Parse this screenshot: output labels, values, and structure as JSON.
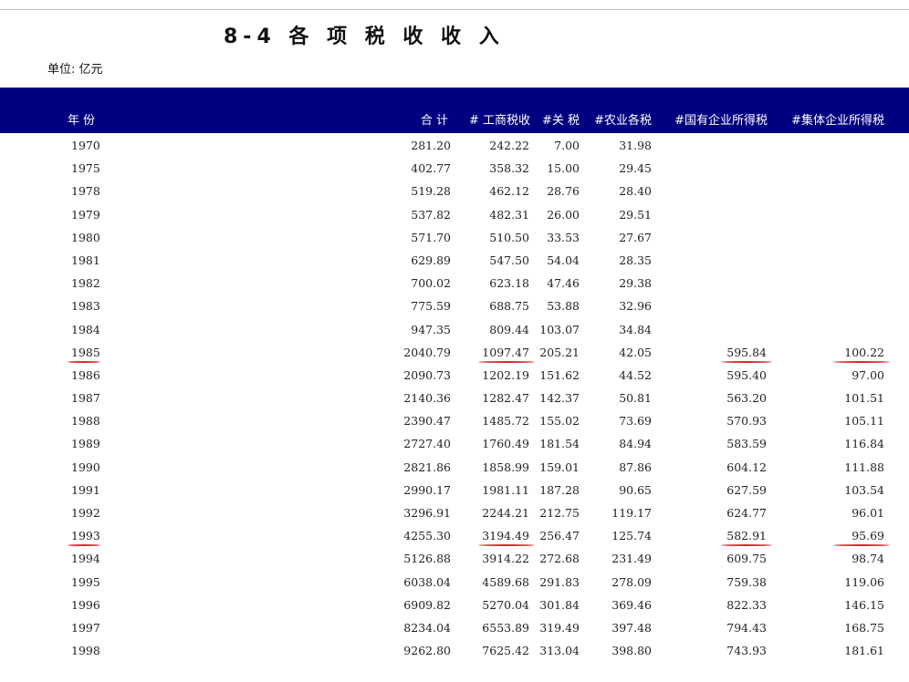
{
  "title": "8-4 各 项 税 收 收 入",
  "unit": "单位: 亿元",
  "accent_colors": {
    "header_band": "#000080",
    "annotation": "#e0202a"
  },
  "table": {
    "headers": [
      "年 份",
      "合 计",
      "# 工商税收",
      "#关 税",
      "#农业各税",
      "#国有企业所得税",
      "#集体企业所得税"
    ],
    "rows": [
      [
        "1970",
        "281.20",
        "242.22",
        "7.00",
        "31.98",
        "",
        ""
      ],
      [
        "1975",
        "402.77",
        "358.32",
        "15.00",
        "29.45",
        "",
        ""
      ],
      [
        "1978",
        "519.28",
        "462.12",
        "28.76",
        "28.40",
        "",
        ""
      ],
      [
        "1979",
        "537.82",
        "482.31",
        "26.00",
        "29.51",
        "",
        ""
      ],
      [
        "1980",
        "571.70",
        "510.50",
        "33.53",
        "27.67",
        "",
        ""
      ],
      [
        "1981",
        "629.89",
        "547.50",
        "54.04",
        "28.35",
        "",
        ""
      ],
      [
        "1982",
        "700.02",
        "623.18",
        "47.46",
        "29.38",
        "",
        ""
      ],
      [
        "1983",
        "775.59",
        "688.75",
        "53.88",
        "32.96",
        "",
        ""
      ],
      [
        "1984",
        "947.35",
        "809.44",
        "103.07",
        "34.84",
        "",
        ""
      ],
      [
        "1985",
        "2040.79",
        "1097.47",
        "205.21",
        "42.05",
        "595.84",
        "100.22"
      ],
      [
        "1986",
        "2090.73",
        "1202.19",
        "151.62",
        "44.52",
        "595.40",
        "97.00"
      ],
      [
        "1987",
        "2140.36",
        "1282.47",
        "142.37",
        "50.81",
        "563.20",
        "101.51"
      ],
      [
        "1988",
        "2390.47",
        "1485.72",
        "155.02",
        "73.69",
        "570.93",
        "105.11"
      ],
      [
        "1989",
        "2727.40",
        "1760.49",
        "181.54",
        "84.94",
        "583.59",
        "116.84"
      ],
      [
        "1990",
        "2821.86",
        "1858.99",
        "159.01",
        "87.86",
        "604.12",
        "111.88"
      ],
      [
        "1991",
        "2990.17",
        "1981.11",
        "187.28",
        "90.65",
        "627.59",
        "103.54"
      ],
      [
        "1992",
        "3296.91",
        "2244.21",
        "212.75",
        "119.17",
        "624.77",
        "96.01"
      ],
      [
        "1993",
        "4255.30",
        "3194.49",
        "256.47",
        "125.74",
        "582.91",
        "95.69"
      ],
      [
        "1994",
        "5126.88",
        "3914.22",
        "272.68",
        "231.49",
        "609.75",
        "98.74"
      ],
      [
        "1995",
        "6038.04",
        "4589.68",
        "291.83",
        "278.09",
        "759.38",
        "119.06"
      ],
      [
        "1996",
        "6909.82",
        "5270.04",
        "301.84",
        "369.46",
        "822.33",
        "146.15"
      ],
      [
        "1997",
        "8234.04",
        "6553.89",
        "319.49",
        "397.48",
        "794.43",
        "168.75"
      ],
      [
        "1998",
        "9262.80",
        "7625.42",
        "313.04",
        "398.80",
        "743.93",
        "181.61"
      ]
    ],
    "underlined_cells": [
      [
        "1985",
        "year"
      ],
      [
        "1985",
        "business"
      ],
      [
        "1985",
        "soe"
      ],
      [
        "1985",
        "collective"
      ],
      [
        "1993",
        "year"
      ],
      [
        "1993",
        "business"
      ],
      [
        "1993",
        "soe"
      ],
      [
        "1993",
        "collective"
      ]
    ]
  }
}
